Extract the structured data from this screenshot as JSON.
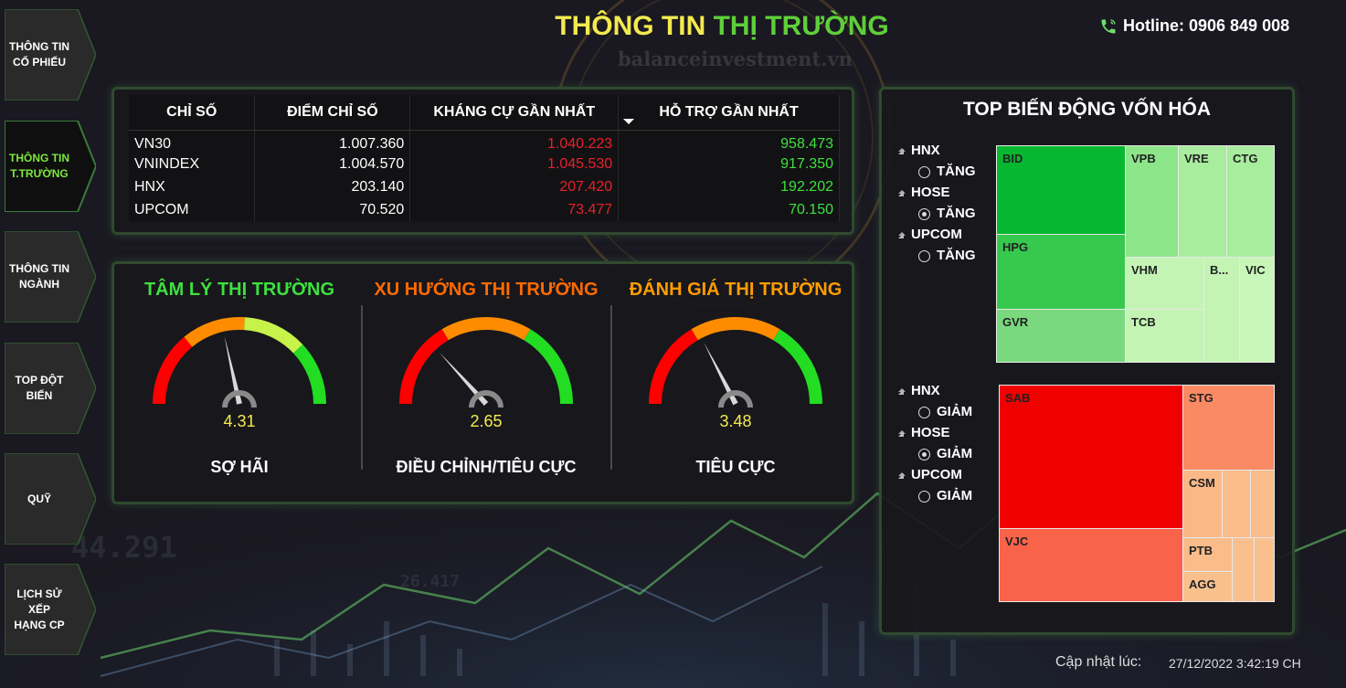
{
  "header": {
    "title_part1": "THÔNG TIN",
    "title_part2": "THỊ TRƯỜNG",
    "hotline": "Hotline: 0906 849 008",
    "watermark": "balanceinvestment.vn"
  },
  "nav": {
    "items": [
      {
        "line1": "THÔNG TIN",
        "line2": "CỔ PHIẾU",
        "active": false
      },
      {
        "line1": "THÔNG TIN",
        "line2": "T.TRƯỜNG",
        "active": true
      },
      {
        "line1": "THÔNG TIN",
        "line2": "NGÀNH",
        "active": false
      },
      {
        "line1": "TOP ĐỘT",
        "line2": "BIẾN",
        "active": false
      },
      {
        "line1": "QUỸ",
        "line2": "",
        "active": false
      },
      {
        "line1": "LỊCH SỬ XẾP",
        "line2": "HẠNG CP",
        "active": false
      }
    ]
  },
  "index_table": {
    "headers": [
      "CHỈ SỐ",
      "ĐIỂM CHỈ SỐ",
      "KHÁNG CỰ GẦN NHẤT",
      "HỖ TRỢ GẦN NHẤT"
    ],
    "rows": [
      {
        "name": "VN30",
        "points": "1.007.360",
        "resistance": "1.040.223",
        "support": "958.473"
      },
      {
        "name": "VNINDEX",
        "points": "1.004.570",
        "resistance": "1.045.530",
        "support": "917.350"
      },
      {
        "name": "HNX",
        "points": "203.140",
        "resistance": "207.420",
        "support": "192.202"
      },
      {
        "name": "UPCOM",
        "points": "70.520",
        "resistance": "73.477",
        "support": "70.150"
      }
    ]
  },
  "gauges": [
    {
      "title": "TÂM LÝ THỊ TRƯỜNG",
      "title_color": "#3ee03e",
      "value": "4.31",
      "fraction": 0.431,
      "status": "SỢ HÃI",
      "segments": [
        "#ff0000",
        "#ff8c00",
        "#c6f24a",
        "#22dd22"
      ]
    },
    {
      "title": "XU HƯỚNG THỊ TRƯỜNG",
      "title_color": "#ff6a00",
      "value": "2.65",
      "fraction": 0.265,
      "status": "ĐIỀU CHỈNH/TIÊU CỰC",
      "segments": [
        "#ff0000",
        "#ff8c00",
        "#22dd22"
      ]
    },
    {
      "title": "ĐÁNH GIÁ THỊ TRƯỜNG",
      "title_color": "#ff9c00",
      "value": "3.48",
      "fraction": 0.348,
      "status": "TIÊU CỰC",
      "segments": [
        "#ff0000",
        "#ff8c00",
        "#22dd22"
      ]
    }
  ],
  "treemap_panel": {
    "title": "TOP BIẾN ĐỘNG VỐN HÓA",
    "up_filters": [
      {
        "exchange": "HNX",
        "option": "TĂNG",
        "checked": false
      },
      {
        "exchange": "HOSE",
        "option": "TĂNG",
        "checked": true
      },
      {
        "exchange": "UPCOM",
        "option": "TĂNG",
        "checked": false
      }
    ],
    "down_filters": [
      {
        "exchange": "HNX",
        "option": "GIẢM",
        "checked": false
      },
      {
        "exchange": "HOSE",
        "option": "GIẢM",
        "checked": true
      },
      {
        "exchange": "UPCOM",
        "option": "GIẢM",
        "checked": false
      }
    ],
    "up_tiles": [
      "BID",
      "VPB",
      "VRE",
      "CTG",
      "HPG",
      "VHM",
      "B...",
      "VIC",
      "GVR",
      "TCB"
    ],
    "down_tiles": [
      "SAB",
      "STG",
      "CSM",
      "VJC",
      "PTB",
      "AGG"
    ]
  },
  "footer": {
    "updated_label": "Cập nhật lúc:",
    "updated_time": "27/12/2022 3:42:19 CH"
  },
  "background": {
    "ticker1": "44.291",
    "ticker2": "26.417"
  }
}
